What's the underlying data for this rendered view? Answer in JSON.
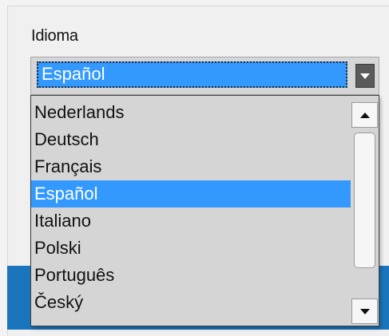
{
  "field_label": "Idioma",
  "combo": {
    "selected_value": "Español"
  },
  "dropdown": {
    "options": [
      {
        "label": "Nederlands"
      },
      {
        "label": "Deutsch"
      },
      {
        "label": "Français"
      },
      {
        "label": "Español",
        "selected": true
      },
      {
        "label": "Italiano"
      },
      {
        "label": "Polski"
      },
      {
        "label": "Português"
      },
      {
        "label": "Český"
      }
    ]
  },
  "colors": {
    "selection": "#3399ff",
    "list_background": "#d5d5d5",
    "band": "#1b75bc"
  },
  "icons": {
    "combo_arrow": "chevron-down-icon",
    "scroll_up": "scroll-up-icon",
    "scroll_down": "scroll-down-icon"
  }
}
